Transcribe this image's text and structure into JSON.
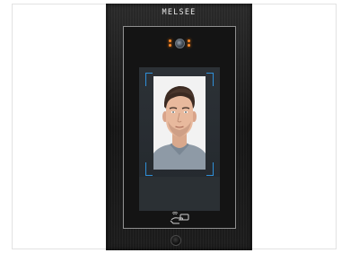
{
  "device": {
    "brand": "MELSEE"
  },
  "icons": {
    "camera": "camera-lens-icon",
    "card": "card-reader-icon",
    "button": "home-button-icon"
  },
  "colors": {
    "accent_bracket": "#2f8fd8",
    "indicator_led": "#ff8a2a",
    "panel_border": "#8f8f8f"
  }
}
